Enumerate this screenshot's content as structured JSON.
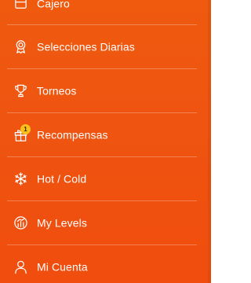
{
  "menu": {
    "items": [
      {
        "label": "Cajero",
        "icon": "cashier-icon"
      },
      {
        "label": "Selecciones Diarias",
        "icon": "award-medal-icon"
      },
      {
        "label": "Torneos",
        "icon": "trophy-icon"
      },
      {
        "label": "Recompensas",
        "icon": "gift-icon",
        "badge": "1"
      },
      {
        "label": "Hot / Cold",
        "icon": "snowflake-flame-icon"
      },
      {
        "label": "My Levels",
        "icon": "levels-gauge-icon"
      },
      {
        "label": "Mi Cuenta",
        "icon": "user-icon"
      }
    ]
  },
  "colors": {
    "background": "#ef5410",
    "text": "#ffffff",
    "badge": "#f8c21a"
  }
}
